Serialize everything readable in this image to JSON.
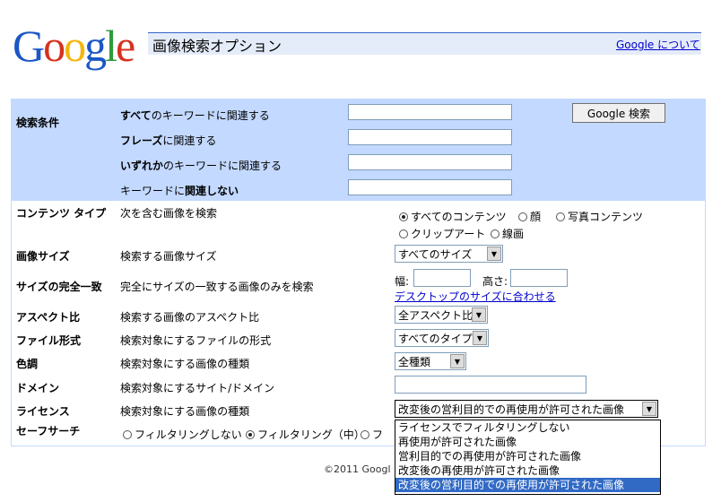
{
  "header": {
    "logo_letters": [
      {
        "ch": "G",
        "color": "#1a57c7"
      },
      {
        "ch": "o",
        "color": "#d7311e"
      },
      {
        "ch": "o",
        "color": "#f5b50a"
      },
      {
        "ch": "g",
        "color": "#1a57c7"
      },
      {
        "ch": "l",
        "color": "#2f9a3a"
      },
      {
        "ch": "e",
        "color": "#d7311e"
      }
    ],
    "title": "画像検索オプション",
    "about_link": "Google について"
  },
  "search": {
    "section_label": "検索条件",
    "all_words_label": "すべてのキーワードに関連する",
    "phrase_label": "フレーズに関連する",
    "any_words_label": "いずれかのキーワードに関連する",
    "not_words_label": "キーワードに関連しない",
    "all_words_value": "",
    "phrase_value": "",
    "any_words_value": "",
    "not_words_value": "",
    "submit_label": "Google 検索"
  },
  "content_type": {
    "label": "コンテンツ タイプ",
    "desc": "次を含む画像を検索",
    "options": [
      "すべてのコンテンツ",
      "顔",
      "写真コンテンツ",
      "クリップアート",
      "線画"
    ],
    "selected": "すべてのコンテンツ"
  },
  "image_size": {
    "label": "画像サイズ",
    "desc": "検索する画像サイズ",
    "value": "すべてのサイズ"
  },
  "exact_size": {
    "label": "サイズの完全一致",
    "desc": "完全にサイズの一致する画像のみを検索",
    "width_label": "幅:",
    "height_label": "高さ:",
    "width_value": "",
    "height_value": "",
    "desktop_link": "デスクトップのサイズに合わせる"
  },
  "aspect": {
    "label": "アスペクト比",
    "desc": "検索する画像のアスペクト比",
    "value": "全アスペクト比"
  },
  "filetype": {
    "label": "ファイル形式",
    "desc": "検索対象にするファイルの形式",
    "value": "すべてのタイプ"
  },
  "color": {
    "label": "色調",
    "desc": "検索対象にする画像の種類",
    "value": "全種類"
  },
  "domain": {
    "label": "ドメイン",
    "desc": "検索対象にするサイト/ドメイン",
    "value": ""
  },
  "license": {
    "label": "ライセンス",
    "desc": "検索対象にする画像の種類",
    "value": "改変後の営利目的での再使用が許可された画像",
    "options": [
      "ライセンスでフィルタリングしない",
      "再使用が許可された画像",
      "営利目的での再使用が許可された画像",
      "改変後の再使用が許可された画像",
      "改変後の営利目的での再使用が許可された画像"
    ],
    "highlighted_index": 4
  },
  "safesearch": {
    "label": "セーフサーチ",
    "options": [
      "フィルタリングしない",
      "フィルタリング（中）",
      "フ"
    ],
    "selected": "フィルタリング（中）"
  },
  "footer": {
    "copyright": "©2011 Googl"
  }
}
